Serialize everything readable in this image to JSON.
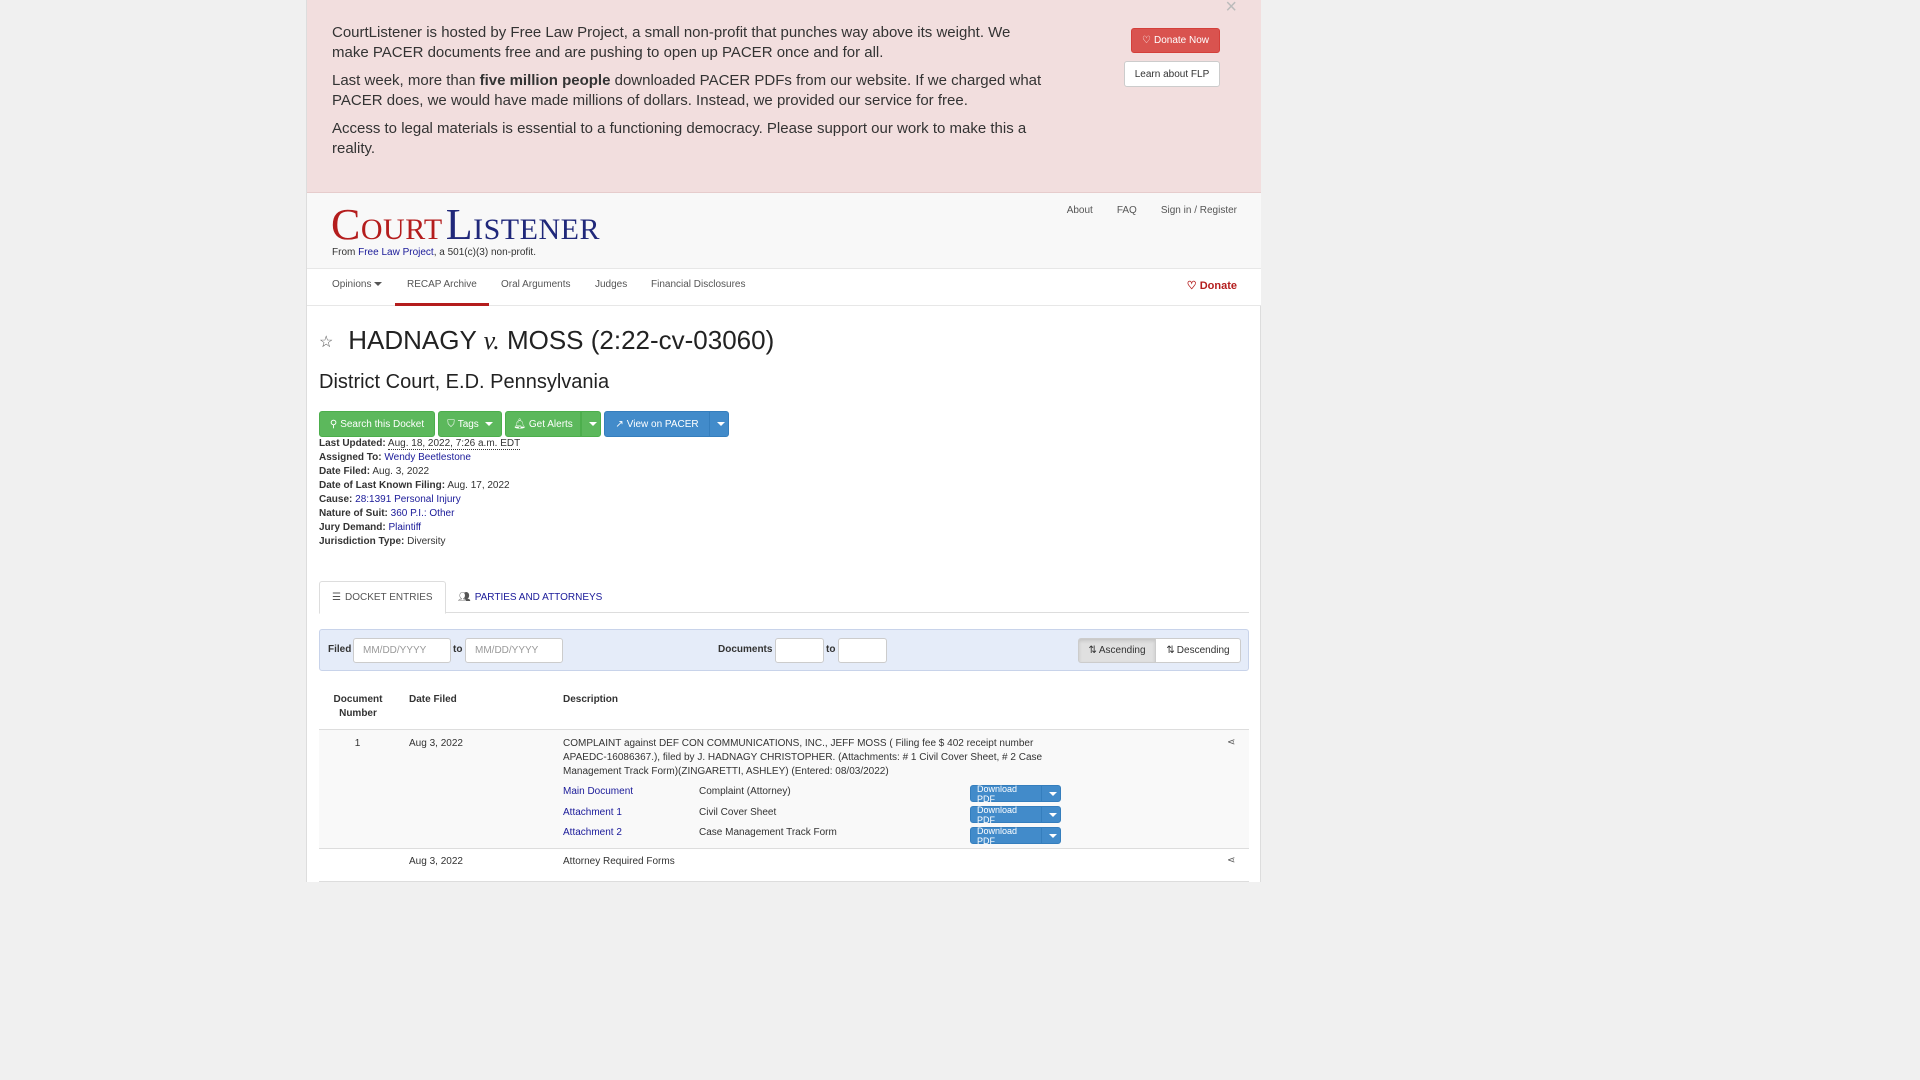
{
  "banner": {
    "p1": "CourtListener is hosted by Free Law Project, a small non-profit that punches way above its weight. We make PACER documents free and are pushing to open up PACER once and for all.",
    "p2_before": "Last week, more than ",
    "p2_bold": "five million people",
    "p2_after": " downloaded PACER PDFs from our website. If we charged what PACER does, we would have made millions of dollars. Instead, we provided our service for free.",
    "p3": "Access to legal materials is essential to a functioning democracy. Please support our work to make this a reality.",
    "close": "×",
    "donate_now": "Donate Now",
    "learn_about": "Learn about FLP"
  },
  "header": {
    "logo_c": "C",
    "logo_ourt": "OURT",
    "logo_l": "L",
    "logo_istener": "ISTENER",
    "from_prefix": "From ",
    "from_link": "Free Law Project",
    "from_suffix": ", a 501(c)(3) non-profit.",
    "top_links": [
      "About",
      "FAQ",
      "Sign in / Register"
    ]
  },
  "nav": {
    "items": [
      "Opinions",
      "RECAP Archive",
      "Oral Arguments",
      "Judges",
      "Financial Disclosures"
    ],
    "donate": "Donate"
  },
  "case": {
    "plaintiff": "HADNAGY",
    "vs": "v.",
    "defendant": "MOSS (2:22-cv-03060)",
    "court": "District Court, E.D. Pennsylvania"
  },
  "actions": {
    "search": "Search this Docket",
    "tags": "Tags",
    "alerts": "Get Alerts",
    "pacer": "View on PACER"
  },
  "meta": [
    {
      "label": "Last Updated:",
      "value": "Aug. 18, 2022, 7:26 a.m. EDT"
    },
    {
      "label": "Assigned To:",
      "value": "Wendy Beetlestone"
    },
    {
      "label": "Date Filed:",
      "value": "Aug. 3, 2022"
    },
    {
      "label": "Date of Last Known Filing:",
      "value": "Aug. 17, 2022"
    },
    {
      "label": "Cause:",
      "value": "28:1391 Personal Injury"
    },
    {
      "label": "Nature of Suit:",
      "value": "360 P.I.: Other"
    },
    {
      "label": "Jury Demand:",
      "value": "Plaintiff"
    },
    {
      "label": "Jurisdiction Type:",
      "value": "Diversity"
    }
  ],
  "tabs": [
    "DOCKET ENTRIES",
    "PARTIES AND ATTORNEYS"
  ],
  "filter": {
    "filed_label": "Filed",
    "to": "to",
    "date_placeholder": "MM/DD/YYYY",
    "documents_label": "Documents",
    "ascending": "Ascending",
    "descending": "Descending"
  },
  "table": {
    "headers": [
      "Document Number",
      "Date Filed",
      "Description"
    ],
    "rows": [
      {
        "number": "1",
        "date": "Aug 3, 2022",
        "description": "COMPLAINT against DEF CON COMMUNICATIONS, INC., JEFF MOSS ( Filing fee $ 402 receipt number APAEDC-16086367.), filed by J. HADNAGY CHRISTOPHER. (Attachments: # 1 Civil Cover Sheet, # 2 Case Management Track Form)(ZINGARETTI, ASHLEY) (Entered: 08/03/2022)",
        "attachments": [
          {
            "name": "Main Document",
            "desc": "Complaint (Attorney)",
            "button": "Download PDF"
          },
          {
            "name": "Attachment 1",
            "desc": "Civil Cover Sheet",
            "button": "Download PDF"
          },
          {
            "name": "Attachment 2",
            "desc": "Case Management Track Form",
            "button": "Download PDF"
          }
        ]
      },
      {
        "number": "",
        "date": "Aug 3, 2022",
        "description": "Attorney Required Forms"
      }
    ]
  }
}
